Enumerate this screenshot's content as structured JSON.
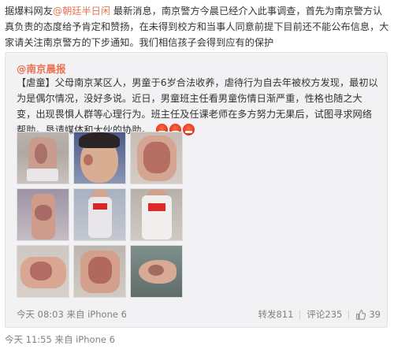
{
  "post": {
    "prefix": "据爆料网友",
    "mention": "@朝廷半日闲",
    "body": " 最新消息，南京警方今晨已经介入此事调查，首先为南京警方认真负责的态度给予肯定和赞扬，在未得到校方和当事人同意前提下目前还不能公布信息，大家请关注南京警方的下步通知。我们相信孩子会得到应有的保护",
    "time": "今天 11:55",
    "source": "来自 iPhone 6"
  },
  "repost": {
    "author": "@南京晨报",
    "text": "【虐童】父母南京某区人，男童于6岁合法收养，虐待行为自去年被校方发现，最初以为是偶尔情况，没好多说。近日，男童班主任看男童伤情日渐严重，性格也随之大变，出现畏惧人群等心理行为。班主任及任课老师在多方努力无果后，试图寻求网络帮助。恳请媒体和大伙的协助。",
    "emoji_icons": [
      "angry-icon",
      "angry-icon",
      "angry-icon"
    ],
    "photos": [
      "photo-child-back-bruises",
      "photo-child-face-injury",
      "photo-back-welts",
      "photo-legs-bruises",
      "photo-child-standing-red-scarf",
      "photo-child-in-uniform",
      "photo-skin-welts-closeup",
      "photo-back-welts-closeup",
      "photo-foot-bruise"
    ],
    "time": "今天 08:03",
    "source": "来自 iPhone 6",
    "reposts_label": "转发",
    "reposts": "811",
    "comments_label": "评论",
    "comments": "235",
    "likes": "39"
  },
  "colors": {
    "mention": "#eb7350",
    "meta": "#808080",
    "repost_bg": "#f2f2f5"
  }
}
